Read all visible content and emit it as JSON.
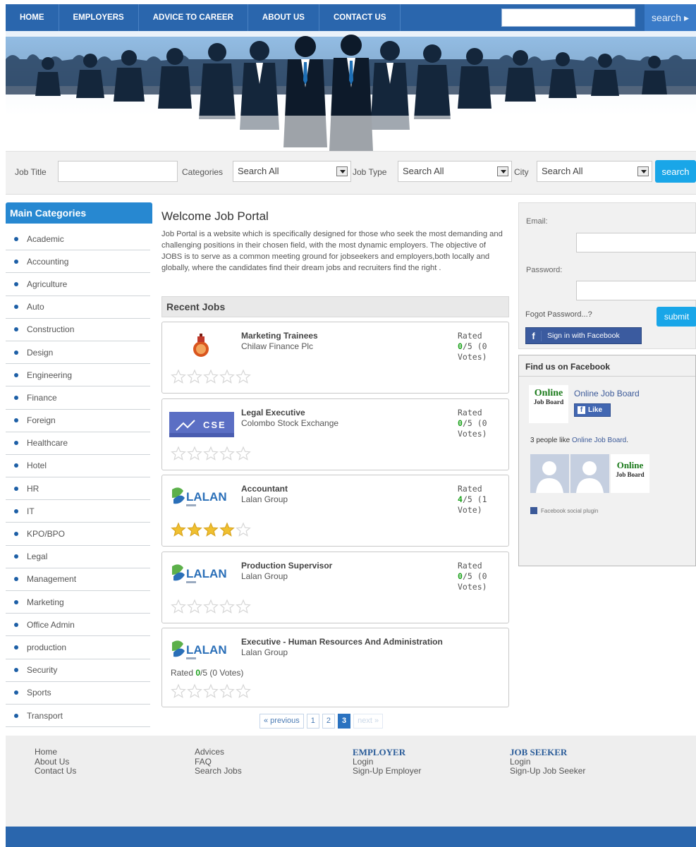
{
  "nav": {
    "items": [
      "HOME",
      "EMPLOYERS",
      "ADVICE TO CAREER",
      "ABOUT US",
      "CONTACT US"
    ],
    "search_button": "search ▸"
  },
  "searchbar": {
    "job_title_label": "Job Title",
    "categories_label": "Categories",
    "categories_value": "Search All",
    "job_type_label": "Job Type",
    "job_type_value": "Search All",
    "city_label": "City",
    "city_value": "Search All",
    "search_button": "search"
  },
  "sidebar": {
    "title": "Main Categories",
    "categories": [
      "Academic",
      "Accounting",
      "Agriculture",
      "Auto",
      "Construction",
      "Design",
      "Engineering",
      "Finance",
      "Foreign",
      "Healthcare",
      "Hotel",
      "HR",
      "IT",
      "KPO/BPO",
      "Legal",
      "Management",
      "Marketing",
      "Office Admin",
      "production",
      "Security",
      "Sports",
      "Transport"
    ]
  },
  "welcome": {
    "title": "Welcome Job Portal",
    "text": "Job Portal is a website which is specifically designed for those who seek the most demanding and challenging positions in their chosen field, with the most dynamic employers. The objective of JOBS is to serve as a common meeting ground for jobseekers and employers,both locally and globally, where the candidates find their dream jobs and recruiters find the right ."
  },
  "recent_jobs": {
    "title": "Recent Jobs",
    "jobs": [
      {
        "title": "Marketing Trainees",
        "company": "Chilaw Finance Plc",
        "rated_label": "Rated",
        "score": "0",
        "out_of": "/5 (0",
        "votes": "Votes)",
        "stars_filled": 0,
        "logo": "chilaw-finance-logo"
      },
      {
        "title": "Legal Executive",
        "company": "Colombo Stock Exchange",
        "rated_label": "Rated",
        "score": "0",
        "out_of": "/5 (0",
        "votes": "Votes)",
        "stars_filled": 0,
        "logo": "cse-logo"
      },
      {
        "title": "Accountant",
        "company": "Lalan Group",
        "rated_label": "Rated",
        "score": "4",
        "out_of": "/5 (1",
        "votes": "Vote)",
        "stars_filled": 4,
        "logo": "lalan-logo"
      },
      {
        "title": "Production Supervisor",
        "company": "Lalan Group",
        "rated_label": "Rated",
        "score": "0",
        "out_of": "/5 (0",
        "votes": "Votes)",
        "stars_filled": 0,
        "logo": "lalan-logo"
      },
      {
        "title": "Executive - Human Resources And Administration",
        "company": "Lalan Group",
        "rated_inline_prefix": "Rated ",
        "score": "0",
        "rated_inline_suffix": "/5 (0 Votes)",
        "stars_filled": 0,
        "logo": "lalan-logo"
      }
    ]
  },
  "pager": {
    "previous": "« previous",
    "pages": [
      "1",
      "2",
      "3"
    ],
    "current": "3",
    "next": "next »"
  },
  "login": {
    "email_label": "Email:",
    "password_label": "Password:",
    "forgot": "Fogot Password...?",
    "submit": "submit",
    "facebook": "Sign in with Facebook"
  },
  "fb_widget": {
    "title": "Find us on Facebook",
    "logo_big": "Online",
    "logo_small": "Job Board",
    "page_name": "Online Job Board",
    "like": "Like",
    "count_prefix": "3 people like ",
    "count_link": "Online Job Board",
    "count_suffix": ".",
    "plugin": "Facebook social plugin"
  },
  "footer": {
    "col1": [
      "Home",
      "About Us",
      "Contact Us"
    ],
    "col2": [
      "Advices",
      "FAQ",
      "Search Jobs"
    ],
    "employer_title": "EMPLOYER",
    "employer_links": [
      "Login",
      "Sign-Up Employer"
    ],
    "seeker_title": "JOB SEEKER",
    "seeker_links": [
      "Login",
      "Sign-Up Job Seeker"
    ]
  },
  "colors": {
    "nav": "#2a66ad",
    "accent": "#19a6e8",
    "rating_green": "#1aa01a",
    "star_gold": "#f0c030"
  }
}
